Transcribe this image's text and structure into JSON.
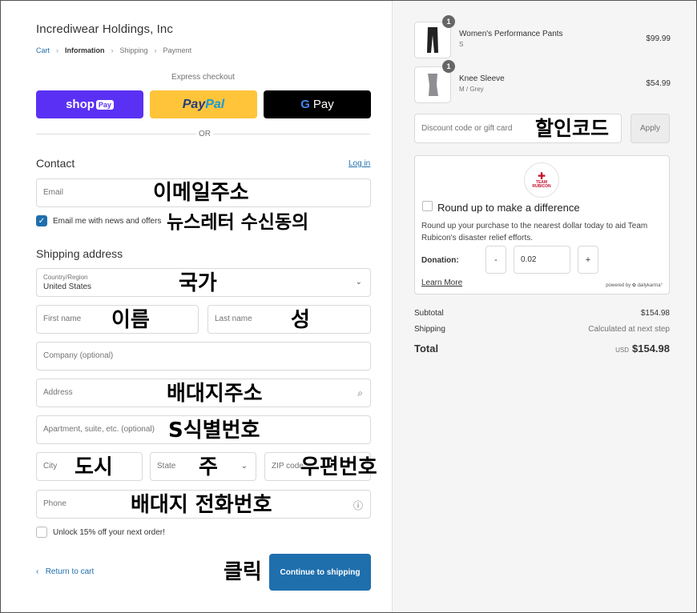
{
  "store": {
    "name": "Incrediwear Holdings, Inc"
  },
  "breadcrumb": {
    "cart": "Cart",
    "information": "Information",
    "shipping": "Shipping",
    "payment": "Payment"
  },
  "express": {
    "label": "Express checkout",
    "shop_label": "shop",
    "shop_pay_chip": "Pay",
    "paypal_a": "Pay",
    "paypal_b": "Pal",
    "gpay_g": "G",
    "gpay_label": "Pay",
    "or_label": "OR"
  },
  "contact": {
    "title": "Contact",
    "login": "Log in",
    "email_placeholder": "Email",
    "email_note": "이메일주소",
    "newsletter_label": "Email me with news and offers",
    "newsletter_checked": true,
    "newsletter_note": "뉴스레터 수신동의"
  },
  "shipping": {
    "title": "Shipping address",
    "country_label": "Country/Region",
    "country_value": "United States",
    "country_note": "국가",
    "first_name": "First name",
    "first_name_note": "이름",
    "last_name": "Last name",
    "last_name_note": "성",
    "company": "Company (optional)",
    "address": "Address",
    "address_note": "배대지주소",
    "apartment": "Apartment, suite, etc. (optional)",
    "apartment_note": "S식별번호",
    "city": "City",
    "city_note": "도시",
    "state": "State",
    "state_note": "주",
    "zip": "ZIP code",
    "zip_note": "우편번호",
    "phone": "Phone",
    "phone_note": "배대지 전화번호",
    "unlock_label": "Unlock 15% off your next order!"
  },
  "actions": {
    "return_label": "Return to cart",
    "continue_label": "Continue to shipping",
    "click_note": "클릭"
  },
  "order": {
    "items": [
      {
        "name": "Women's Performance Pants",
        "variant": "S",
        "price": "$99.99",
        "qty": "1"
      },
      {
        "name": "Knee Sleeve",
        "variant": "M / Grey",
        "price": "$54.99",
        "qty": "1"
      }
    ],
    "discount_placeholder": "Discount code or gift card",
    "discount_note": "할인코드",
    "apply_label": "Apply"
  },
  "roundup": {
    "logo_line1": "TEAM",
    "logo_line2": "RUBICON",
    "title": "Round up to make a difference",
    "description": "Round up your purchase to the nearest dollar today to aid Team Rubicon's disaster relief efforts.",
    "donation_label": "Donation:",
    "minus": "-",
    "donation_value": "0.02",
    "plus": "+",
    "learn_more": "Learn More",
    "powered_by": "powered by ✿ dailykarma°"
  },
  "summary": {
    "subtotal_label": "Subtotal",
    "subtotal_value": "$154.98",
    "shipping_label": "Shipping",
    "shipping_value": "Calculated at next step",
    "total_label": "Total",
    "currency": "USD",
    "total_value": "$154.98"
  },
  "colors": {
    "primary": "#1f6fad",
    "shop_pay": "#5a31f4",
    "paypal": "#ffc439",
    "gpay": "#000000"
  }
}
